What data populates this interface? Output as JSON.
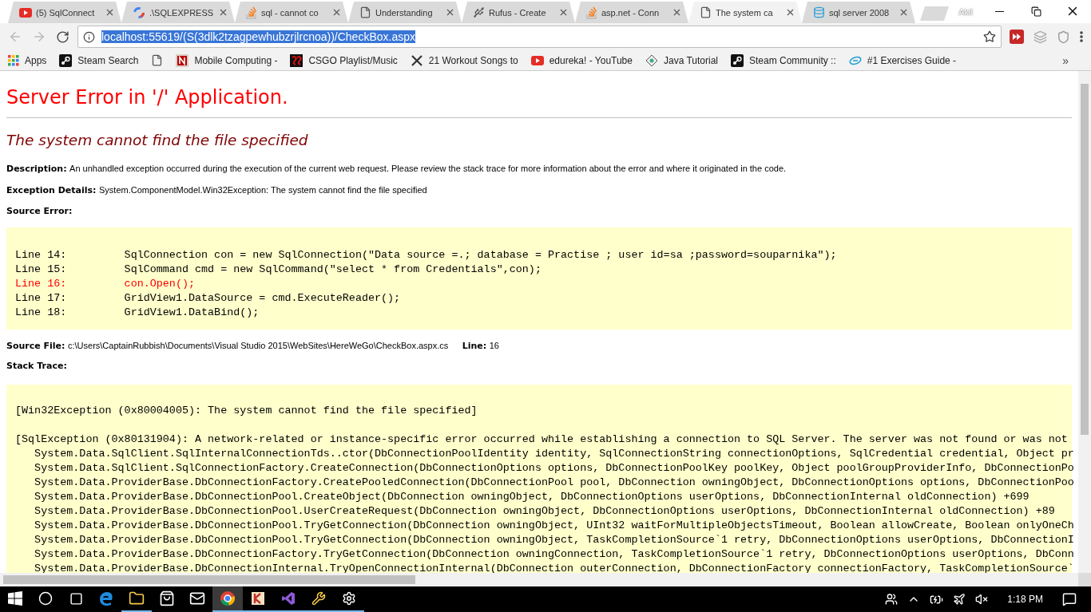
{
  "window": {
    "profile": "Akil"
  },
  "tabs": [
    {
      "title": "(5) SqlConnect",
      "kind": "video",
      "selected": false
    },
    {
      "title": ".\\SQLEXPRESS",
      "kind": "ring",
      "selected": false
    },
    {
      "title": "sql - cannot co",
      "kind": "stack",
      "selected": false
    },
    {
      "title": "Understanding",
      "kind": "page",
      "selected": false
    },
    {
      "title": "Rufus - Create",
      "kind": "usb",
      "selected": false
    },
    {
      "title": "asp.net - Conn",
      "kind": "stack",
      "selected": false
    },
    {
      "title": "The system ca",
      "kind": "page",
      "selected": true
    },
    {
      "title": "sql server 2008",
      "kind": "database",
      "selected": false
    }
  ],
  "address_bar": {
    "url": "localhost:55619/(S(3dlk2tzagpewhubzrjlrcnoa))/CheckBox.aspx",
    "text_selected": true
  },
  "bookmarks": [
    {
      "title": "Apps",
      "kind": "grid"
    },
    {
      "title": "Steam Search",
      "kind": "steam"
    },
    {
      "kind": "page"
    },
    {
      "title": "Mobile Computing -",
      "kind": "letter"
    },
    {
      "title": "CSGO Playlist/Music",
      "kind": "red"
    },
    {
      "title": "21 Workout Songs to",
      "kind": "cross"
    },
    {
      "title": "edureka! - YouTube",
      "kind": "video"
    },
    {
      "title": "Java Tutorial",
      "kind": "diamond"
    },
    {
      "title": "Steam Community ::",
      "kind": "steam"
    },
    {
      "title": "#1 Exercises Guide -",
      "kind": "e"
    }
  ],
  "bookmarks_more": "»",
  "page": {
    "heading": "Server Error in '/' Application.",
    "error_title": "The system cannot find the file specified",
    "fields": [
      {
        "label": "Description:",
        "value": "An unhandled exception occurred during the execution of the current web request. Please review the stack trace for more information about the error and where it originated in the code."
      },
      {
        "label": "Exception Details:",
        "value": "System.ComponentModel.Win32Exception: The system cannot find the file specified"
      }
    ],
    "source_error_label": "Source Error:",
    "source_lines": [
      {
        "text": "Line 14:         SqlConnection con = new SqlConnection(\"Data source =.; database = Practise ; user id=sa ;password=souparnika\");",
        "error": false
      },
      {
        "text": "Line 15:         SqlCommand cmd = new SqlCommand(\"select * from Credentials\",con);",
        "error": false
      },
      {
        "text": "Line 16:         con.Open();",
        "error": true
      },
      {
        "text": "Line 17:         GridView1.DataSource = cmd.ExecuteReader();",
        "error": false
      },
      {
        "text": "Line 18:         GridView1.DataBind();",
        "error": false
      }
    ],
    "source_file_label": "Source File:",
    "source_file": "c:\\Users\\CaptainRubbish\\Documents\\Visual Studio 2015\\WebSites\\HereWeGo\\CheckBox.aspx.cs",
    "line_label": "Line:",
    "line": "16",
    "stack_trace_label": "Stack Trace:",
    "stack_trace": [
      [
        "[Win32Exception (0x80004005): The system cannot find the file specified]"
      ],
      [
        "[SqlException (0x80131904): A network-related or instance-specific error occurred while establishing a connection to SQL Server. The server was not found or was not",
        "   System.Data.SqlClient.SqlInternalConnectionTds..ctor(DbConnectionPoolIdentity identity, SqlConnectionString connectionOptions, SqlCredential credential, Object pr",
        "   System.Data.SqlClient.SqlConnectionFactory.CreateConnection(DbConnectionOptions options, DbConnectionPoolKey poolKey, Object poolGroupProviderInfo, DbConnectionPo",
        "   System.Data.ProviderBase.DbConnectionFactory.CreatePooledConnection(DbConnectionPool pool, DbConnection owningObject, DbConnectionOptions options, DbConnectionPoo",
        "   System.Data.ProviderBase.DbConnectionPool.CreateObject(DbConnection owningObject, DbConnectionOptions userOptions, DbConnectionInternal oldConnection) +699",
        "   System.Data.ProviderBase.DbConnectionPool.UserCreateRequest(DbConnection owningObject, DbConnectionOptions userOptions, DbConnectionInternal oldConnection) +89",
        "   System.Data.ProviderBase.DbConnectionPool.TryGetConnection(DbConnection owningObject, UInt32 waitForMultipleObjectsTimeout, Boolean allowCreate, Boolean onlyOneCh",
        "   System.Data.ProviderBase.DbConnectionPool.TryGetConnection(DbConnection owningObject, TaskCompletionSource`1 retry, DbConnectionOptions userOptions, DbConnectionI",
        "   System.Data.ProviderBase.DbConnectionFactory.TryGetConnection(DbConnection owningConnection, TaskCompletionSource`1 retry, DbConnectionOptions userOptions, DbConn",
        "   System.Data.ProviderBase.DbConnectionInternal.TryOpenConnectionInternal(DbConnection outerConnection, DbConnectionFactory connectionFactory, TaskCompletionSource`"
      ]
    ]
  },
  "taskbar": {
    "apps": [
      {
        "kind": "edge",
        "running": false,
        "selected": false
      },
      {
        "kind": "folder",
        "running": true,
        "selected": false
      },
      {
        "kind": "bag",
        "running": false,
        "selected": false
      },
      {
        "kind": "mail",
        "running": false,
        "selected": false
      },
      {
        "kind": "chrome",
        "running": true,
        "selected": true
      },
      {
        "kind": "k",
        "running": true,
        "selected": false
      },
      {
        "kind": "vs",
        "running": true,
        "selected": false
      },
      {
        "kind": "tool",
        "running": true,
        "selected": false
      },
      {
        "kind": "gear",
        "running": true,
        "selected": false
      }
    ],
    "time": "1:18 PM"
  }
}
